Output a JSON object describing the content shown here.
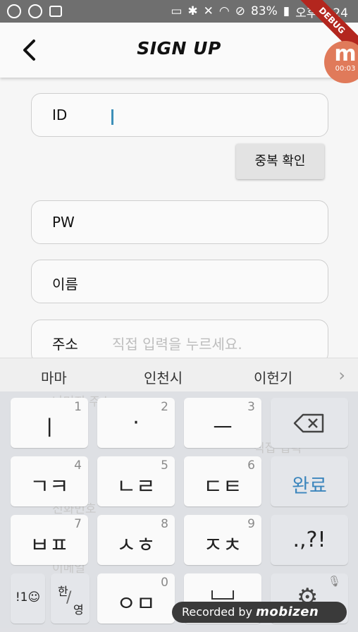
{
  "statusbar": {
    "battery": "83%",
    "time": "오후 2:24",
    "icons": [
      "mobizen-icon",
      "sync-icon",
      "bag-icon",
      "cast-icon",
      "bluetooth-icon",
      "mute-icon",
      "wifi-icon",
      "dnd-icon",
      "battery-icon"
    ]
  },
  "appbar": {
    "title": "SIGN UP",
    "debug_banner": "DEBUG"
  },
  "mobizen_badge": {
    "letter": "m",
    "timer": "00:03"
  },
  "form": {
    "id_label": "ID",
    "pw_label": "PW",
    "name_label": "이름",
    "address_label": "주소",
    "address_placeholder": "직접 입력을 누르세요.",
    "dup_check_button": "중복 확인",
    "ghost_detail_address": "나머지 주소",
    "ghost_manual_input": "직접 입력",
    "ghost_phone": "전화번호",
    "ghost_email": "이메일"
  },
  "suggestions": [
    "마마",
    "인천시",
    "이헌기"
  ],
  "keyboard": {
    "row1": [
      {
        "main": "ㅣ",
        "num": "1"
      },
      {
        "main": "·",
        "num": "2"
      },
      {
        "main": "ㅡ",
        "num": "3"
      }
    ],
    "row2": [
      {
        "main": "ㄱㅋ",
        "num": "4"
      },
      {
        "main": "ㄴㄹ",
        "num": "5"
      },
      {
        "main": "ㄷㅌ",
        "num": "6"
      }
    ],
    "done": "완료",
    "row3": [
      {
        "main": "ㅂㅍ",
        "num": "7"
      },
      {
        "main": "ㅅㅎ",
        "num": "8"
      },
      {
        "main": "ㅈㅊ",
        "num": "9"
      }
    ],
    "punct": ".,?!",
    "symbols": "!1☺",
    "lang_top": "한",
    "lang_bottom": "영",
    "zero_main": "ㅇㅁ",
    "zero_num": "0"
  },
  "recorder": {
    "prefix": "Recorded by",
    "brand": "mobizen"
  },
  "colors": {
    "accent": "#3c86bd",
    "caret": "#3d8fb8",
    "debug": "#b3261e",
    "mobizen": "#e07a5a"
  }
}
